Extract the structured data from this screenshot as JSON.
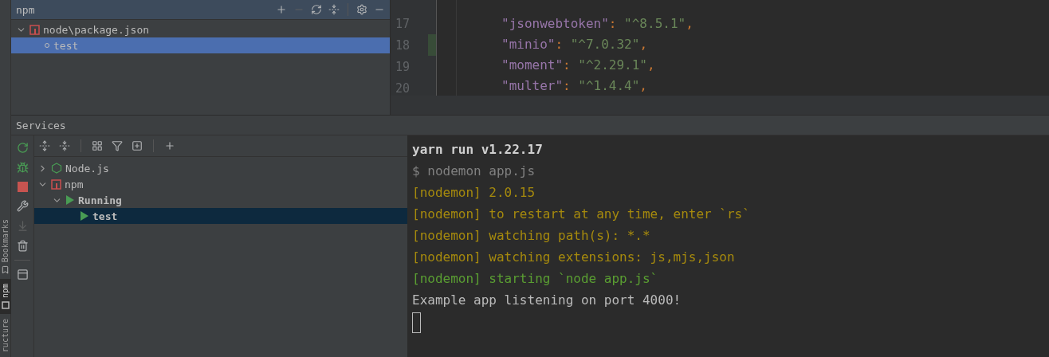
{
  "side_tabs": [
    {
      "label": "Bookmarks",
      "kind": "bookmark",
      "selected": false
    },
    {
      "label": "npm",
      "kind": "npm",
      "selected": true
    },
    {
      "label": "ructure",
      "kind": "none",
      "selected": false
    }
  ],
  "npm_panel": {
    "title": "npm",
    "tree": [
      {
        "label": "node\\package.json",
        "kind": "npm",
        "expanded": true,
        "selected": false,
        "children": [
          {
            "label": "test",
            "kind": "script",
            "selected": true
          }
        ]
      }
    ]
  },
  "editor": {
    "lines": [
      {
        "number": "17",
        "key": "\"jsonwebtoken\"",
        "colon": ":",
        "value": "\"^8.5.1\"",
        "comma": ",",
        "changed": false
      },
      {
        "number": "18",
        "key": "\"minio\"",
        "colon": ":",
        "value": "\"^7.0.32\"",
        "comma": ",",
        "changed": true
      },
      {
        "number": "19",
        "key": "\"moment\"",
        "colon": ":",
        "value": "\"^2.29.1\"",
        "comma": ",",
        "changed": false
      },
      {
        "number": "20",
        "key": "\"multer\"",
        "colon": ":",
        "value": "\"^1.4.4\"",
        "comma": ",",
        "changed": false
      }
    ]
  },
  "services": {
    "title": "Services",
    "tree": [
      {
        "label": "Node.js",
        "kind": "nodejs",
        "expanded": false,
        "selected": false
      },
      {
        "label": "npm",
        "kind": "npm",
        "expanded": true,
        "selected": false,
        "children": [
          {
            "label": "Running",
            "kind": "run",
            "expanded": true,
            "selected": false,
            "children": [
              {
                "label": "test",
                "kind": "run",
                "selected": true
              }
            ]
          }
        ]
      }
    ]
  },
  "console": {
    "lines": [
      {
        "kind": "header",
        "text": "yarn run v1.22.17"
      },
      {
        "kind": "command",
        "text": "$ nodemon app.js"
      },
      {
        "kind": "warn",
        "text": "[nodemon] 2.0.15"
      },
      {
        "kind": "warn",
        "text": "[nodemon] to restart at any time, enter `rs`"
      },
      {
        "kind": "warn",
        "text": "[nodemon] watching path(s): *.*"
      },
      {
        "kind": "warn",
        "text": "[nodemon] watching extensions: js,mjs,json"
      },
      {
        "kind": "info",
        "text": "[nodemon] starting `node app.js`"
      },
      {
        "kind": "plain",
        "text": "Example app listening on port 4000!"
      }
    ]
  }
}
